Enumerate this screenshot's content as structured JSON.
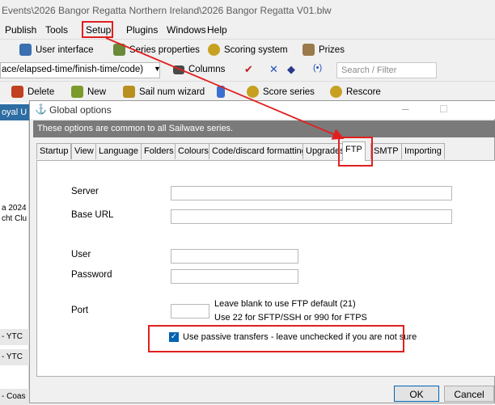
{
  "window": {
    "title": "Events\\2026 Bangor Regatta Northern Ireland\\2026 Bangor Regatta V01.blw"
  },
  "menu": {
    "items": [
      "Publish",
      "Tools",
      "Setup",
      "Plugins",
      "Windows",
      "Help"
    ]
  },
  "toolbar1": {
    "user_interface": "User interface",
    "series_properties": "Series properties",
    "scoring_system": "Scoring system",
    "prizes": "Prizes"
  },
  "toolbar2": {
    "filter_value": "ace/elapsed-time/finish-time/code)",
    "columns": "Columns",
    "search_placeholder": "Search / Filter"
  },
  "toolbar3": {
    "delete": "Delete",
    "new": "New",
    "sail_num_wizard": "Sail num wizard",
    "score_series": "Score series",
    "rescore": "Rescore"
  },
  "left_pane": {
    "rows": [
      "oyal U",
      "a 2024",
      "cht Clu",
      "- YTC",
      "- YTC",
      "- Coas"
    ]
  },
  "dialog": {
    "title": "Global options",
    "info": "These options are common to all Sailwave series.",
    "tabs": [
      "Startup",
      "View",
      "Language",
      "Folders",
      "Colours",
      "Code/discard formatting",
      "Upgrades",
      "FTP",
      "SMTP",
      "Importing"
    ],
    "active_tab": "FTP",
    "fields": {
      "server": {
        "label": "Server",
        "value": ""
      },
      "base_url": {
        "label": "Base URL",
        "value": ""
      },
      "user": {
        "label": "User",
        "value": ""
      },
      "password": {
        "label": "Password",
        "value": ""
      },
      "port": {
        "label": "Port",
        "value": ""
      }
    },
    "port_note_1": "Leave blank to use FTP default (21)",
    "port_note_2": "Use 22  for SFTP/SSH or 990 for FTPS",
    "passive_label": "Use passive transfers - leave unchecked if you are not sure",
    "passive_checked": true,
    "ok": "OK",
    "cancel": "Cancel"
  },
  "colors": {
    "highlight": "#e02020",
    "info_bar": "#7a7a7a",
    "checkbox": "#0063b1"
  }
}
